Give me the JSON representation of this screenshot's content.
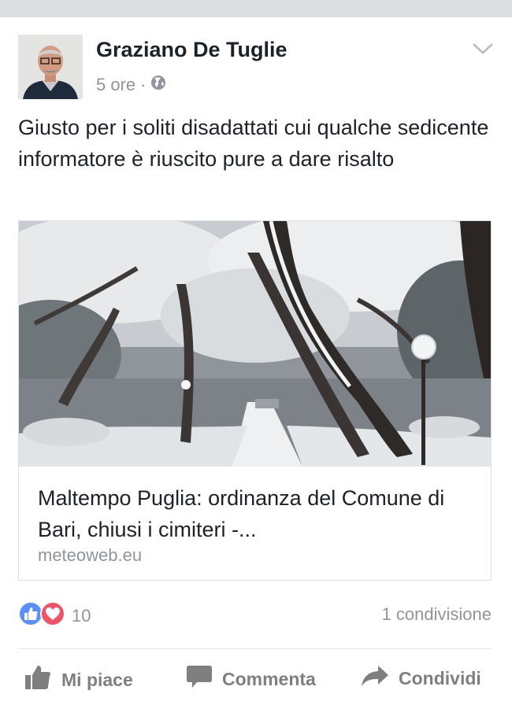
{
  "post": {
    "author": "Graziano De Tuglie",
    "time": "5 ore",
    "separator": "·",
    "text": "Giusto per i soliti disadattati cui qualche sedicente informatore è riuscito pure a dare risalto"
  },
  "link": {
    "title": "Maltempo Puglia: ordinanza del Comune di Bari, chiusi i cimiteri -...",
    "domain": "meteoweb.eu"
  },
  "stats": {
    "reactions_count": "10",
    "shares": "1 condivisione"
  },
  "actions": {
    "like": "Mi piace",
    "comment": "Commenta",
    "share": "Condividi"
  },
  "icons": {
    "privacy": "globe-icon",
    "menu": "chevron-down-icon",
    "like_reaction": "thumbs-up-icon",
    "love_reaction": "heart-icon",
    "like_action": "thumbs-up-icon",
    "comment_action": "speech-bubble-icon",
    "share_action": "share-arrow-icon"
  },
  "colors": {
    "text": "#1d2129",
    "secondary": "#90949c",
    "like_blue": "#5890ff",
    "love_red": "#f25268",
    "action_gray": "#7f7f7f"
  }
}
